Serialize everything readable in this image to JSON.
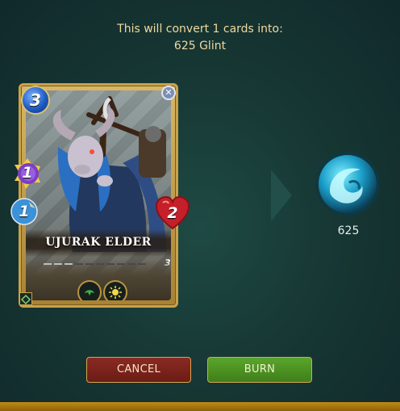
{
  "header": {
    "line1": "This will convert 1 cards into:",
    "line2": "625 Glint"
  },
  "card": {
    "name": "UJURAK ELDER",
    "mana": "3",
    "magic": "1",
    "speed": "1",
    "health": "2",
    "level": "3",
    "level_segments_total": 10,
    "level_segments_filled": 3,
    "abilities": [
      "ability-green-icon",
      "ability-sun-icon"
    ]
  },
  "reward": {
    "amount": "625",
    "icon": "glint-orb-icon"
  },
  "buttons": {
    "cancel": "CANCEL",
    "burn": "BURN"
  },
  "colors": {
    "accent_gold": "#c9a24a",
    "cancel_red": "#7a241d",
    "burn_green": "#4e9624",
    "header_text": "#f0d9a0"
  }
}
